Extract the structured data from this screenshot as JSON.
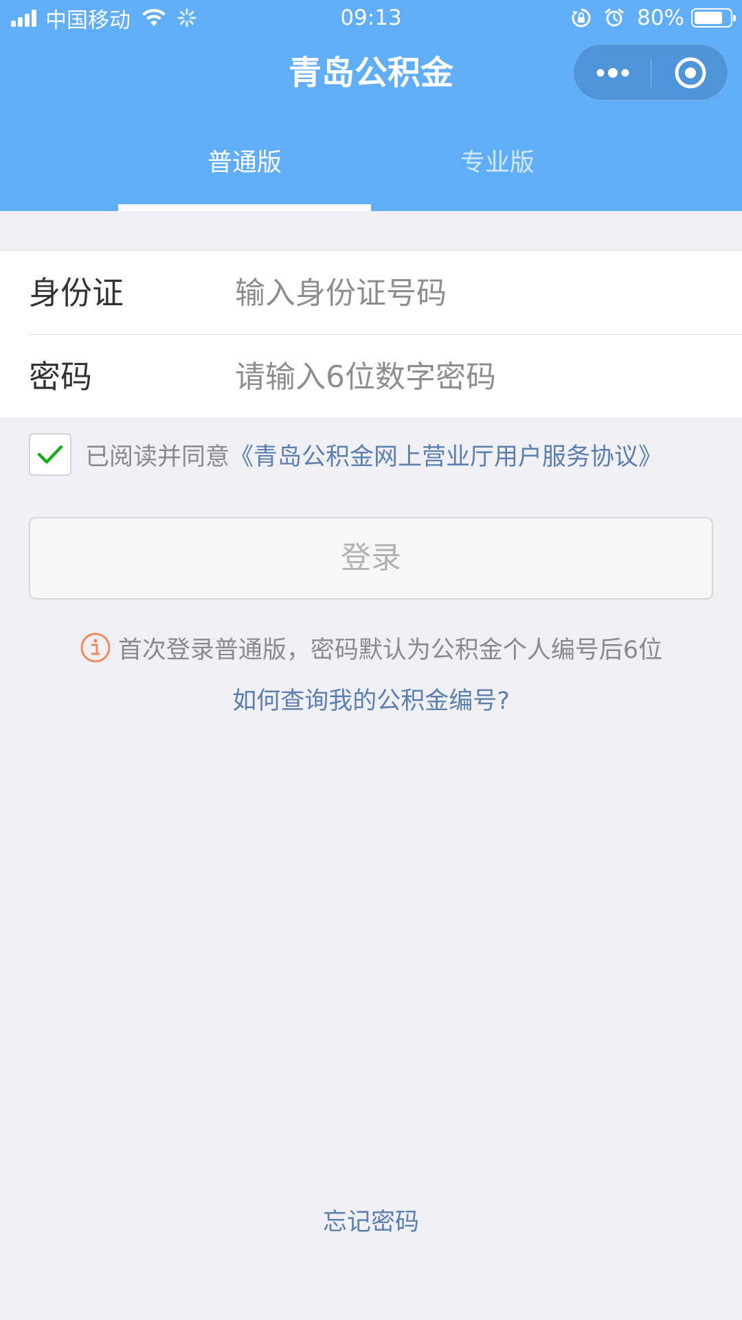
{
  "status_bar": {
    "carrier": "中国移动",
    "time": "09:13",
    "battery_percent": "80%",
    "battery_level": 0.8,
    "icons": [
      "signal-icon",
      "wifi-icon",
      "loading-icon",
      "rotation-lock-icon",
      "alarm-icon",
      "battery-icon"
    ]
  },
  "header": {
    "title": "青岛公积金",
    "capsule_icons": [
      "more-dots-icon",
      "close-target-icon"
    ]
  },
  "tabs": [
    {
      "label": "普通版",
      "active": true
    },
    {
      "label": "专业版",
      "active": false
    }
  ],
  "form": {
    "id_label": "身份证",
    "id_placeholder": "输入身份证号码",
    "password_label": "密码",
    "password_placeholder": "请输入6位数字密码"
  },
  "agreement": {
    "checked": true,
    "prefix": "已阅读并同意",
    "link_text": "《青岛公积金网上营业厅用户服务协议》"
  },
  "login_button": "登录",
  "tip_text": "首次登录普通版，密码默认为公积金个人编号后6位",
  "query_link": "如何查询我的公积金编号?",
  "forgot_link": "忘记密码",
  "colors": {
    "header_bg": "#5faef7",
    "link": "#5b7fae",
    "check": "#1aad19",
    "info": "#f08a5d"
  }
}
